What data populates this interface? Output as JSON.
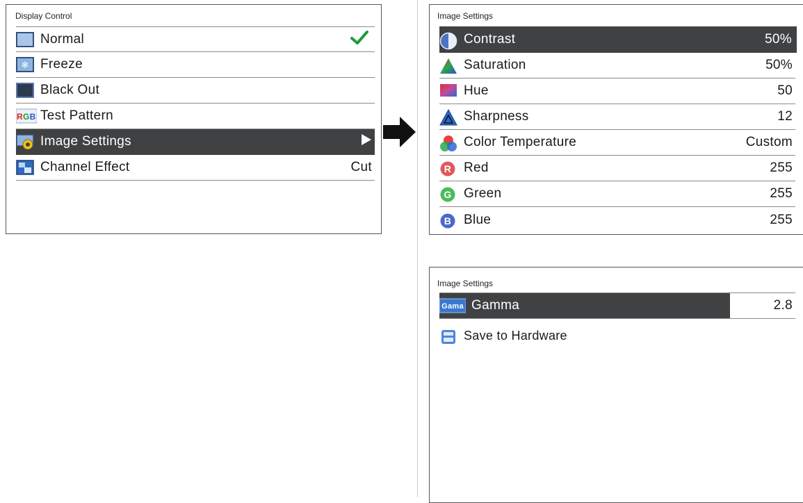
{
  "display_control": {
    "title": "Display Control",
    "items": [
      {
        "label": "Normal",
        "value": "",
        "icon": "normal-screen-icon",
        "checked": true
      },
      {
        "label": "Freeze",
        "value": "",
        "icon": "freeze-icon"
      },
      {
        "label": "Black Out",
        "value": "",
        "icon": "black-out-icon"
      },
      {
        "label": "Test Pattern",
        "value": "",
        "icon": "rgb-test-pattern-icon",
        "icon_text": "RGB"
      },
      {
        "label": "Image Settings",
        "value": "",
        "icon": "image-settings-icon",
        "selected": true,
        "has_submenu": true
      },
      {
        "label": "Channel Effect",
        "value": "Cut",
        "icon": "channel-effect-icon"
      }
    ]
  },
  "image_settings_1": {
    "title": "Image Settings",
    "items": [
      {
        "label": "Contrast",
        "value": "50%",
        "icon": "contrast-icon",
        "selected": true
      },
      {
        "label": "Saturation",
        "value": "50%",
        "icon": "saturation-icon"
      },
      {
        "label": "Hue",
        "value": "50",
        "icon": "hue-icon"
      },
      {
        "label": "Sharpness",
        "value": "12",
        "icon": "sharpness-icon"
      },
      {
        "label": "Color Temperature",
        "value": "Custom",
        "icon": "color-temperature-icon"
      },
      {
        "label": "Red",
        "value": "255",
        "icon": "red-channel-icon",
        "letter": "R"
      },
      {
        "label": "Green",
        "value": "255",
        "icon": "green-channel-icon",
        "letter": "G"
      },
      {
        "label": "Blue",
        "value": "255",
        "icon": "blue-channel-icon",
        "letter": "B"
      }
    ]
  },
  "image_settings_2": {
    "title": "Image Settings",
    "items": [
      {
        "label": "Gamma",
        "value": "2.8",
        "icon": "gamma-icon",
        "icon_text": "Gama",
        "selected": true
      },
      {
        "label": "Save to Hardware",
        "value": "",
        "icon": "save-icon"
      }
    ]
  },
  "colors": {
    "selected_bg": "#3f4143",
    "check_green": "#1f9a3a",
    "divider": "#8a8a8a"
  }
}
